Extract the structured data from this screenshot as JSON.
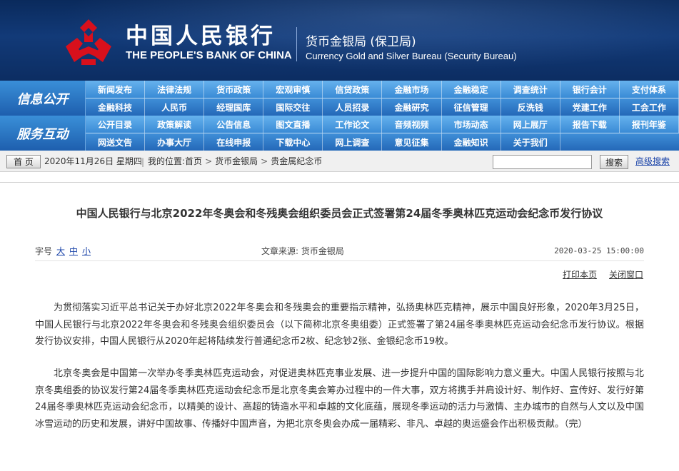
{
  "header": {
    "bank_name_cn": "中国人民银行",
    "bank_name_en": "THE PEOPLE'S BANK OF CHINA",
    "bureau_cn": "货币金银局 (保卫局)",
    "bureau_en": "Currency  Gold and Silver Bureau (Security Bureau)",
    "logo_icon": "pboc-logo-icon",
    "colors": {
      "banner": "#0c2d62",
      "logo_red": "#d8101c"
    }
  },
  "nav": {
    "info_section": "信息公开",
    "service_section": "服务互动",
    "info_row1": [
      "新闻发布",
      "法律法规",
      "货币政策",
      "宏观审慎",
      "信贷政策",
      "金融市场",
      "金融稳定",
      "调查统计",
      "银行会计",
      "支付体系"
    ],
    "info_row2": [
      "金融科技",
      "人民币",
      "经理国库",
      "国际交往",
      "人员招录",
      "金融研究",
      "征信管理",
      "反洗钱",
      "党建工作",
      "工会工作"
    ],
    "service_row1": [
      "公开目录",
      "政策解读",
      "公告信息",
      "图文直播",
      "工作论文",
      "音频视频",
      "市场动态",
      "网上展厅",
      "报告下载",
      "报刊年鉴"
    ],
    "service_row2": [
      "网送文告",
      "办事大厅",
      "在线申报",
      "下载中心",
      "网上调查",
      "意见征集",
      "金融知识",
      "关于我们"
    ]
  },
  "crumbbar": {
    "home": "首 页",
    "date": "2020年11月26日  星期四",
    "divider": "|",
    "location_label": "我的位置:",
    "crumbs": [
      "首页",
      "货币金银局",
      "贵金属纪念币"
    ],
    "arrow": ">",
    "search_value": "",
    "search_button": "搜索",
    "advanced_search": "高级搜索"
  },
  "article": {
    "title": "中国人民银行与北京2022年冬奥会和冬残奥会组织委员会正式签署第24届冬季奥林匹克运动会纪念币发行协议",
    "font_size_label": "字号",
    "font_sizes": [
      "大",
      "中",
      "小"
    ],
    "source": "文章来源:  货币金银局",
    "published": "2020-03-25  15:00:00",
    "print": "打印本页",
    "close": "关闭窗口",
    "paragraphs": [
      "为贯彻落实习近平总书记关于办好北京2022年冬奥会和冬残奥会的重要指示精神，弘扬奥林匹克精神，展示中国良好形象，2020年3月25日，中国人民银行与北京2022年冬奥会和冬残奥会组织委员会（以下简称北京冬奥组委）正式签署了第24届冬季奥林匹克运动会纪念币发行协议。根据发行协议安排，中国人民银行从2020年起将陆续发行普通纪念币2枚、纪念钞2张、金银纪念币19枚。",
      "北京冬奥会是中国第一次举办冬季奥林匹克运动会，对促进奥林匹克事业发展、进一步提升中国的国际影响力意义重大。中国人民银行按照与北京冬奥组委的协议发行第24届冬季奥林匹克运动会纪念币是北京冬奥会筹办过程中的一件大事，双方将携手并肩设计好、制作好、宣传好、发行好第24届冬季奥林匹克运动会纪念币，以精美的设计、高超的铸造水平和卓越的文化底蕴，展现冬季运动的活力与激情、主办城市的自然与人文以及中国冰雪运动的历史和发展，讲好中国故事、传播好中国声音，为把北京冬奥会办成一届精彩、非凡、卓越的奥运盛会作出积极贡献。（完）"
    ]
  }
}
